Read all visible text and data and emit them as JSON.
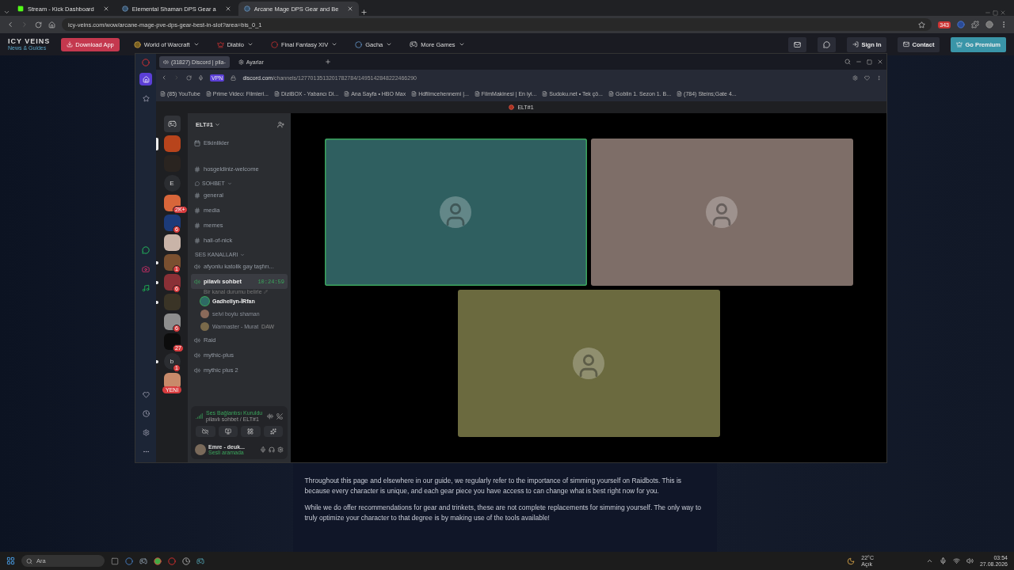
{
  "browser": {
    "tabs": [
      {
        "title": "Stream - Kick Dashboard",
        "kind": "kick",
        "selected": false
      },
      {
        "title": "Elemental Shaman DPS Gear a",
        "kind": "site",
        "selected": false
      },
      {
        "title": "Arcane Mage DPS Gear and Be",
        "kind": "site",
        "selected": true
      }
    ],
    "url": "icy-veins.com/wow/arcane-mage-pve-dps-gear-best-in-slot?area=bis_0_1",
    "extension_badge": "343"
  },
  "site_nav": {
    "logo": "ICY VEINS",
    "tagline": "News & Guides",
    "download": "Download App",
    "menus": [
      {
        "label": "World of Warcraft",
        "kind": "wow"
      },
      {
        "label": "Diablo",
        "kind": "diablo"
      },
      {
        "label": "Final Fantasy XIV",
        "kind": "ff"
      },
      {
        "label": "Gacha",
        "kind": "gacha"
      },
      {
        "label": "More Games",
        "kind": "games"
      }
    ],
    "sign_in": "Sign In",
    "contact": "Contact",
    "premium": "Go Premium"
  },
  "discord": {
    "tabs": [
      {
        "title": "(31827) Discord | pila-",
        "selected": true
      },
      {
        "title": "Ayarlar",
        "selected": false
      }
    ],
    "vpn": "VPN",
    "url_host": "discord.com",
    "url_path": "/channels/1277013513201782784/1495142848222466290",
    "bookmarks": [
      "(85) YouTube",
      "Prime Video: Filmleri...",
      "DiziBOX - Yabancı Di...",
      "Ana Sayfa • HBO Max",
      "Hdfilmcehennemi |...",
      "FilmMakinesi | En iyi...",
      "Sudoku.net • Tek çö...",
      "Goblin 1. Sezon 1. B...",
      "(784) Steins;Gate 4..."
    ],
    "page_title": "ELT#1",
    "servers": [
      {
        "kind": "avatar",
        "color": "#b8441c",
        "selected": true,
        "unread": false
      },
      {
        "kind": "avatar",
        "color": "#2a2420",
        "selected": false,
        "unread": false
      },
      {
        "kind": "letter",
        "letter": "E",
        "color": "#2b2d31",
        "selected": false,
        "unread": false
      },
      {
        "kind": "avatar",
        "color": "#d8663a",
        "badge": "2K+",
        "selected": false,
        "unread": false
      },
      {
        "kind": "avatar",
        "color": "#1c3b7a",
        "badge": "6",
        "selected": false,
        "unread": false
      },
      {
        "kind": "avatar",
        "color": "#c9b4a8",
        "selected": false,
        "unread": false
      },
      {
        "kind": "avatar",
        "color": "#7a5030",
        "badge": "1",
        "selected": false,
        "unread": true
      },
      {
        "kind": "avatar",
        "color": "#8a3036",
        "badge": "6",
        "selected": false,
        "unread": true
      },
      {
        "kind": "avatar",
        "color": "#3a3426",
        "selected": false,
        "unread": true
      },
      {
        "kind": "avatar",
        "color": "#8e8e8e",
        "badge": "6",
        "selected": false,
        "unread": false
      },
      {
        "kind": "avatar",
        "color": "#0c0c0c",
        "badge": "27",
        "selected": false,
        "unread": false
      },
      {
        "kind": "letter",
        "letter": "b",
        "color": "#2b2d31",
        "badge": "1",
        "selected": false,
        "unread": true
      },
      {
        "kind": "avatar",
        "color": "#c88a6a",
        "pill": "YENİ",
        "selected": false,
        "unread": false
      }
    ],
    "server_name": "ELT#1",
    "channels": [
      {
        "kind": "event",
        "name": "Etkinlikler"
      },
      {
        "kind": "text",
        "name": "hosgeldiniz-welcome"
      },
      {
        "kind": "category",
        "name": "SOHBET",
        "icon": true
      },
      {
        "kind": "text",
        "name": "general"
      },
      {
        "kind": "text",
        "name": "media"
      },
      {
        "kind": "text",
        "name": "memes"
      },
      {
        "kind": "text",
        "name": "hall-of-nick"
      },
      {
        "kind": "category",
        "name": "SES KANALLARI",
        "icon": false
      },
      {
        "kind": "voice",
        "name": "afyonlu katolik gay taşfırı...",
        "selected": false
      },
      {
        "kind": "voice",
        "name": "pilavlı sohbet",
        "selected": true,
        "time": "10:24:59",
        "status": "Bir kanal durumu belirle",
        "members": [
          {
            "name": "Gadhellyn-İRfan",
            "speaking": true,
            "color": "#2e6a64"
          },
          {
            "name": "selvi boylu shaman",
            "speaking": false,
            "color": "#8a6a5a"
          },
          {
            "name": "Warmaster - Murat",
            "extra": "DAW",
            "speaking": false,
            "color": "#7a6a4a"
          }
        ]
      },
      {
        "kind": "voice",
        "name": "Raid",
        "selected": false
      },
      {
        "kind": "voice",
        "name": "mythic-plus",
        "selected": false
      },
      {
        "kind": "voice",
        "name": "mythic plus 2",
        "selected": false
      }
    ],
    "voice": {
      "status": "Ses Bağlantısı Kuruldu",
      "where": "pilavlı sohbet / ELT#1"
    },
    "user": {
      "name": "Emre - deuk...",
      "activity": "Sesli aramada"
    },
    "tiles": [
      {
        "color": "#2f5f60",
        "speaking": true
      },
      {
        "color": "#7e6e68",
        "speaking": false
      },
      {
        "color": "#6b6a3f",
        "speaking": false
      }
    ]
  },
  "article": {
    "paragraphs": [
      "Throughout this page and elsewhere in our guide, we regularly refer to the importance of simming yourself on Raidbots. This is because every character is unique, and each gear piece you have access to can change what is best right now for you.",
      "While we do offer recommendations for gear and trinkets, these are not complete replacements for simming yourself. The only way to truly optimize your character to that degree is by making use of the tools available!"
    ]
  },
  "taskbar": {
    "search": "Ara",
    "temp": "22°C",
    "weather": "Açık",
    "time": "03:54",
    "date": "27.08.2026"
  }
}
